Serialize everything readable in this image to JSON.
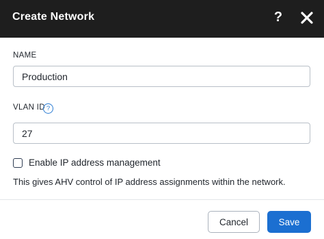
{
  "dialog": {
    "title": "Create Network",
    "help_glyph": "?",
    "close_icon": "close-icon"
  },
  "form": {
    "name_label": "NAME",
    "name_value": "Production",
    "vlan_label": "VLAN ID",
    "vlan_info_glyph": "?",
    "vlan_value": "27",
    "ipam_checkbox_checked": false,
    "ipam_checkbox_label": "Enable IP address management",
    "ipam_hint": "This gives AHV control of IP address assignments within the network."
  },
  "footer": {
    "cancel_label": "Cancel",
    "save_label": "Save"
  },
  "colors": {
    "header_bg": "#1e1e1e",
    "primary": "#1b6fd1",
    "info_blue": "#2b7cd3",
    "border": "#b8bfc7"
  }
}
